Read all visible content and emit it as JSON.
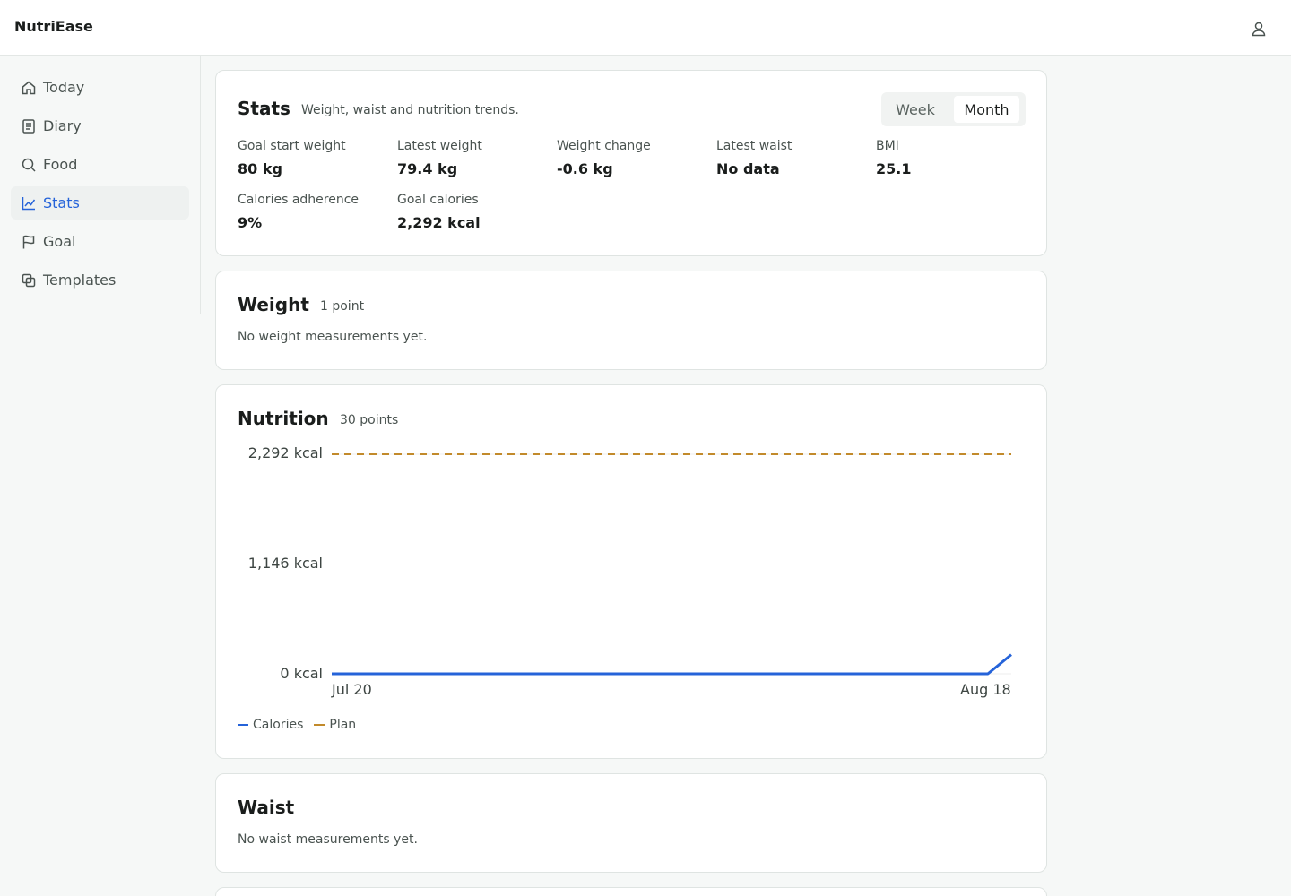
{
  "app": {
    "title": "NutriEase"
  },
  "header": {
    "user_icon": "user-icon"
  },
  "sidebar": {
    "items": [
      {
        "label": "Today",
        "icon": "home-icon"
      },
      {
        "label": "Diary",
        "icon": "diary-icon"
      },
      {
        "label": "Food",
        "icon": "search-icon"
      },
      {
        "label": "Stats",
        "icon": "chart-icon",
        "active": true
      },
      {
        "label": "Goal",
        "icon": "flag-icon"
      },
      {
        "label": "Templates",
        "icon": "copy-icon"
      }
    ]
  },
  "stats": {
    "title": "Stats",
    "subtitle": "Weight, waist and nutrition trends.",
    "range_options": [
      "Week",
      "Month"
    ],
    "selected_range": "Month",
    "metrics": [
      {
        "label": "Goal start weight",
        "value": "80 kg"
      },
      {
        "label": "Latest weight",
        "value": "79.4 kg"
      },
      {
        "label": "Weight change",
        "value": "-0.6 kg"
      },
      {
        "label": "Latest waist",
        "value": "No data"
      },
      {
        "label": "BMI",
        "value": "25.1"
      },
      {
        "label": "Calories adherence",
        "value": "9%"
      },
      {
        "label": "Goal calories",
        "value": "2,292 kcal"
      }
    ]
  },
  "weight": {
    "title": "Weight",
    "count": "1 point",
    "empty": "No weight measurements yet."
  },
  "nutrition": {
    "title": "Nutrition",
    "count": "30 points"
  },
  "waist": {
    "title": "Waist",
    "empty": "No waist measurements yet."
  },
  "colors": {
    "accent": "#2563d9",
    "plan": "#c28a2b"
  },
  "chart_data": {
    "type": "line",
    "x": [
      "Jul 20",
      "Jul 21",
      "Jul 22",
      "Jul 23",
      "Jul 24",
      "Jul 25",
      "Jul 26",
      "Jul 27",
      "Jul 28",
      "Jul 29",
      "Jul 30",
      "Jul 31",
      "Aug 1",
      "Aug 2",
      "Aug 3",
      "Aug 4",
      "Aug 5",
      "Aug 6",
      "Aug 7",
      "Aug 8",
      "Aug 9",
      "Aug 10",
      "Aug 11",
      "Aug 12",
      "Aug 13",
      "Aug 14",
      "Aug 15",
      "Aug 16",
      "Aug 17",
      "Aug 18"
    ],
    "x_tick_labels": [
      "Jul 20",
      "Aug 18"
    ],
    "y_tick_labels": [
      "2,292 kcal",
      "1,146 kcal",
      "0 kcal"
    ],
    "ylim": [
      0,
      2292
    ],
    "series": [
      {
        "name": "Calories",
        "color": "#2563d9",
        "style": "solid",
        "values": [
          0,
          0,
          0,
          0,
          0,
          0,
          0,
          0,
          0,
          0,
          0,
          0,
          0,
          0,
          0,
          0,
          0,
          0,
          0,
          0,
          0,
          0,
          0,
          0,
          0,
          0,
          0,
          0,
          0,
          200
        ]
      },
      {
        "name": "Plan",
        "color": "#c28a2b",
        "style": "dashed",
        "values": [
          2292,
          2292,
          2292,
          2292,
          2292,
          2292,
          2292,
          2292,
          2292,
          2292,
          2292,
          2292,
          2292,
          2292,
          2292,
          2292,
          2292,
          2292,
          2292,
          2292,
          2292,
          2292,
          2292,
          2292,
          2292,
          2292,
          2292,
          2292,
          2292,
          2292
        ]
      }
    ],
    "grid": true,
    "legend": "bottom-left"
  }
}
